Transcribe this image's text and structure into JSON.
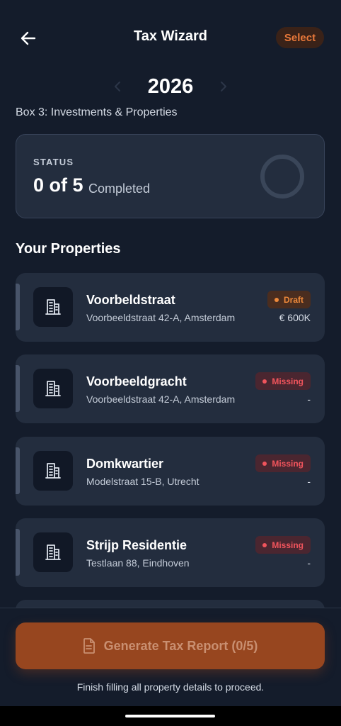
{
  "header": {
    "title": "Tax Wizard",
    "select_label": "Select"
  },
  "year": "2026",
  "box_label": "Box 3: Investments & Properties",
  "status": {
    "label": "STATUS",
    "count": "0 of 5",
    "completed_label": "Completed",
    "progress": 0
  },
  "properties_title": "Your Properties",
  "properties": [
    {
      "name": "Voorbeldstraat",
      "address": "Voorbeeldstraat 42-A, Amsterdam",
      "badge": "Draft",
      "value": "€ 600K"
    },
    {
      "name": "Voorbeeldgracht",
      "address": "Voorbeeldstraat 42-A, Amsterdam",
      "badge": "Missing",
      "value": "-"
    },
    {
      "name": "Domkwartier",
      "address": "Modelstraat 15-B, Utrecht",
      "badge": "Missing",
      "value": "-"
    },
    {
      "name": "Strijp Residentie",
      "address": "Testlaan 88, Eindhoven",
      "badge": "Missing",
      "value": "-"
    }
  ],
  "generate_button": "Generate Tax Report (0/5)",
  "generate_hint": "Finish filling all property details to proceed.",
  "colors": {
    "background": "#141c2b",
    "card": "#232d3e",
    "accent": "#97461f",
    "draft": "#ef8a3b",
    "missing": "#f0545c"
  },
  "icons": {
    "back": "arrow-left-icon",
    "prev_year": "chevron-left-icon",
    "next_year": "chevron-right-icon",
    "property": "building-icon",
    "report": "document-icon"
  }
}
